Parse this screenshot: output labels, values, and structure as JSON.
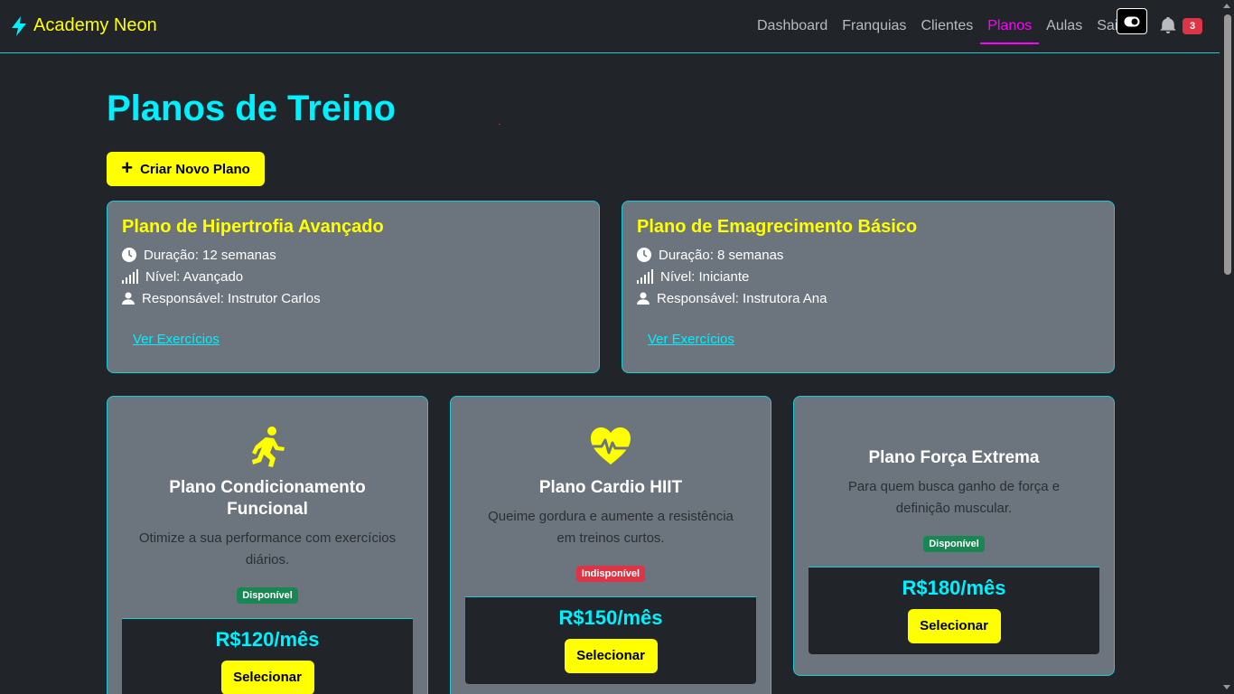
{
  "brand": {
    "name": "Academy Neon"
  },
  "nav": {
    "links": [
      "Dashboard",
      "Franquias",
      "Clientes",
      "Planos",
      "Aulas",
      "Sair"
    ],
    "active": "Planos",
    "notification_count": "3"
  },
  "colors": {
    "accent": "#00f0ff",
    "highlight": "#ffff00",
    "active_nav": "#ff00ff",
    "card_bg": "#6c757d",
    "page_bg": "#212529"
  },
  "page": {
    "title": "Planos de Treino",
    "create_button": "Criar Novo Plano"
  },
  "plans": [
    {
      "title": "Plano de Hipertrofia Avançado",
      "duration": "Duração: 12 semanas",
      "level": "Nível: Avançado",
      "responsible": "Responsável: Instrutor Carlos",
      "link": "Ver Exercícios"
    },
    {
      "title": "Plano de Emagrecimento Básico",
      "duration": "Duração: 8 semanas",
      "level": "Nível: Iniciante",
      "responsible": "Responsável: Instrutora Ana",
      "link": "Ver Exercícios"
    }
  ],
  "offers": [
    {
      "icon": "running-person-icon",
      "title": "Plano Condicionamento Funcional",
      "description": "Otimize a sua performance com exercícios diários.",
      "status": "Disponível",
      "price": "R$120/mês",
      "button": "Selecionar"
    },
    {
      "icon": "heart-pulse-icon",
      "title": "Plano Cardio HIIT",
      "description": "Queime gordura e aumente a resistência em treinos curtos.",
      "status": "Indisponível",
      "price": "R$150/mês",
      "button": "Selecionar"
    },
    {
      "icon": "",
      "title": "Plano Força Extrema",
      "description": "Para quem busca ganho de força e definição muscular.",
      "status": "Disponível",
      "price": "R$180/mês",
      "button": "Selecionar"
    }
  ]
}
